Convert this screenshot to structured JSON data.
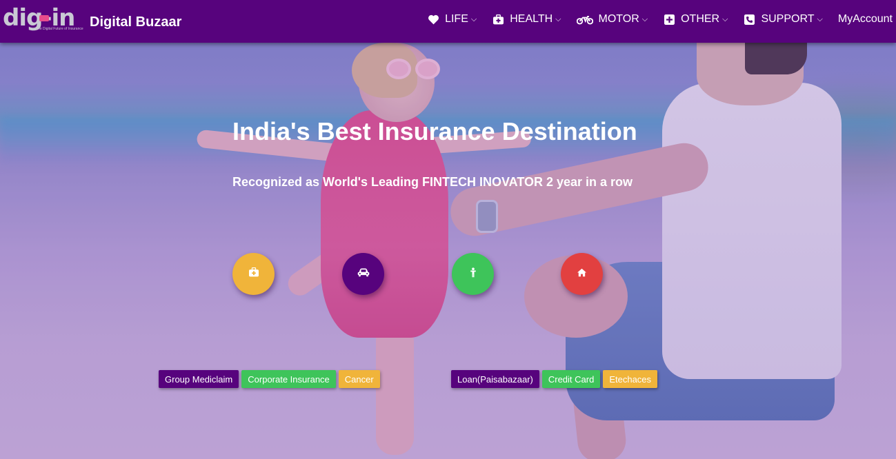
{
  "header": {
    "logo_text": "dig-in",
    "logo_tagline": "The Digital Future of Insurance",
    "brand": "Digital Buzaar",
    "nav": [
      {
        "label": "LIFE",
        "icon": "heart-icon"
      },
      {
        "label": "HEALTH",
        "icon": "medical-kit-icon"
      },
      {
        "label": "MOTOR",
        "icon": "motorcycle-icon"
      },
      {
        "label": "OTHER",
        "icon": "plus-square-icon"
      },
      {
        "label": "SUPPORT",
        "icon": "phone-icon"
      }
    ],
    "account_label": "MyAccount"
  },
  "hero": {
    "title": "India's Best Insurance Destination",
    "subtitle": "Recognized as World's Leading FINTECH INOVATOR 2 year in a row",
    "category_buttons": [
      {
        "icon": "medical-kit-icon",
        "color": "#f0b43a"
      },
      {
        "icon": "car-icon",
        "color": "#57037d"
      },
      {
        "icon": "person-icon",
        "color": "#3ec45a"
      },
      {
        "icon": "home-icon",
        "color": "#e24040"
      }
    ],
    "tag_group_left": [
      {
        "label": "Group Mediclaim",
        "color": "#57037d"
      },
      {
        "label": "Corporate Insurance",
        "color": "#3ec45a"
      },
      {
        "label": "Cancer",
        "color": "#f0b43a"
      }
    ],
    "tag_group_right": [
      {
        "label": "Loan(Paisabazaar)",
        "color": "#57037d"
      },
      {
        "label": "Credit Card",
        "color": "#3ec45a"
      },
      {
        "label": "Etechaces",
        "color": "#f0b43a"
      }
    ]
  },
  "colors": {
    "navbar": "#57037d",
    "yellow": "#f0b43a",
    "green": "#3ec45a",
    "red": "#e24040"
  }
}
